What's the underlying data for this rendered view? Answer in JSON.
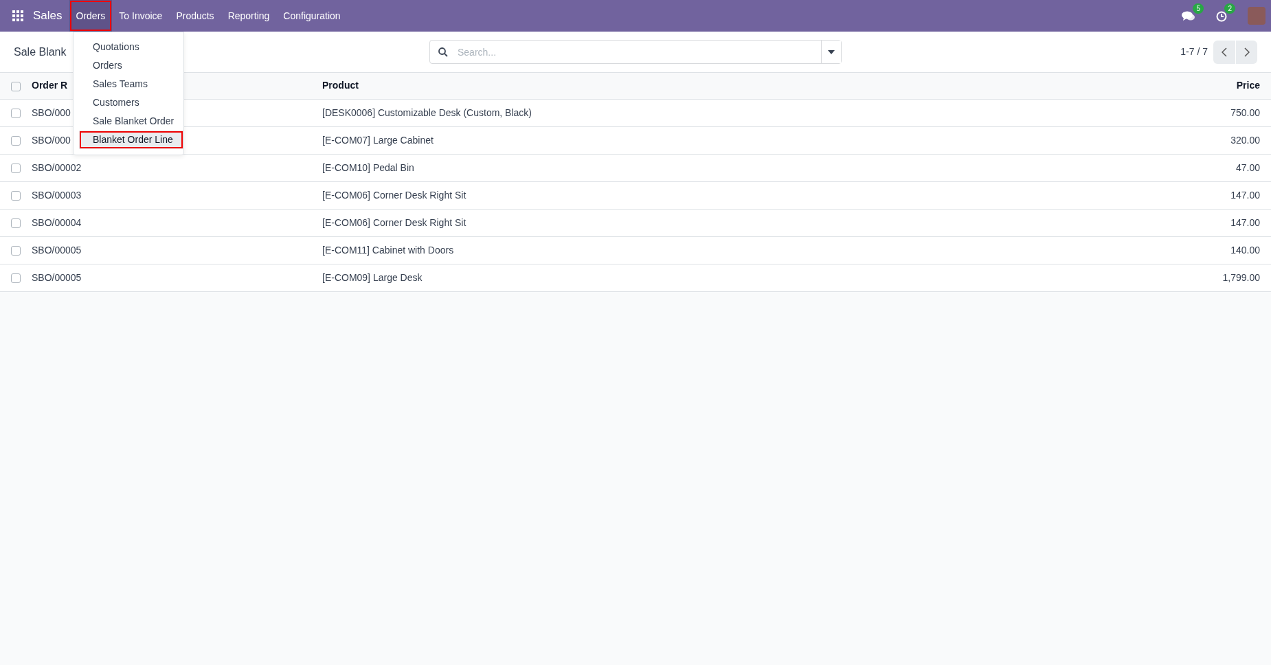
{
  "navbar": {
    "app": "Sales",
    "menus": [
      {
        "label": "Orders",
        "selected": true,
        "annotated": true
      },
      {
        "label": "To Invoice",
        "selected": false,
        "annotated": false
      },
      {
        "label": "Products",
        "selected": false,
        "annotated": false
      },
      {
        "label": "Reporting",
        "selected": false,
        "annotated": false
      },
      {
        "label": "Configuration",
        "selected": false,
        "annotated": false
      }
    ],
    "messages_badge": "5",
    "activities_badge": "2"
  },
  "dropdown": {
    "items": [
      {
        "label": "Quotations",
        "selected": false,
        "annotated": false
      },
      {
        "label": "Orders",
        "selected": false,
        "annotated": false
      },
      {
        "label": "Sales Teams",
        "selected": false,
        "annotated": false
      },
      {
        "label": "Customers",
        "selected": false,
        "annotated": false
      },
      {
        "label": "Sale Blanket Order",
        "selected": false,
        "annotated": false
      },
      {
        "label": "Blanket Order Line",
        "selected": true,
        "annotated": true
      }
    ]
  },
  "control_panel": {
    "title": "Sale Blank",
    "search": {
      "placeholder": "Search..."
    },
    "pager": "1-7 / 7"
  },
  "table": {
    "all_checked": false,
    "columns": [
      "Order R",
      "Product",
      "Price"
    ],
    "rows": [
      {
        "checked": false,
        "cells": [
          "SBO/000",
          "[DESK0006] Customizable Desk (Custom, Black)",
          "750.00"
        ]
      },
      {
        "checked": false,
        "cells": [
          "SBO/000",
          "[E-COM07] Large Cabinet",
          "320.00"
        ]
      },
      {
        "checked": false,
        "cells": [
          "SBO/00002",
          "[E-COM10] Pedal Bin",
          "47.00"
        ]
      },
      {
        "checked": false,
        "cells": [
          "SBO/00003",
          "[E-COM06] Corner Desk Right Sit",
          "147.00"
        ]
      },
      {
        "checked": false,
        "cells": [
          "SBO/00004",
          "[E-COM06] Corner Desk Right Sit",
          "147.00"
        ]
      },
      {
        "checked": false,
        "cells": [
          "SBO/00005",
          "[E-COM11] Cabinet with Doors",
          "140.00"
        ]
      },
      {
        "checked": false,
        "cells": [
          "SBO/00005",
          "[E-COM09] Large Desk",
          "1,799.00"
        ]
      }
    ]
  }
}
